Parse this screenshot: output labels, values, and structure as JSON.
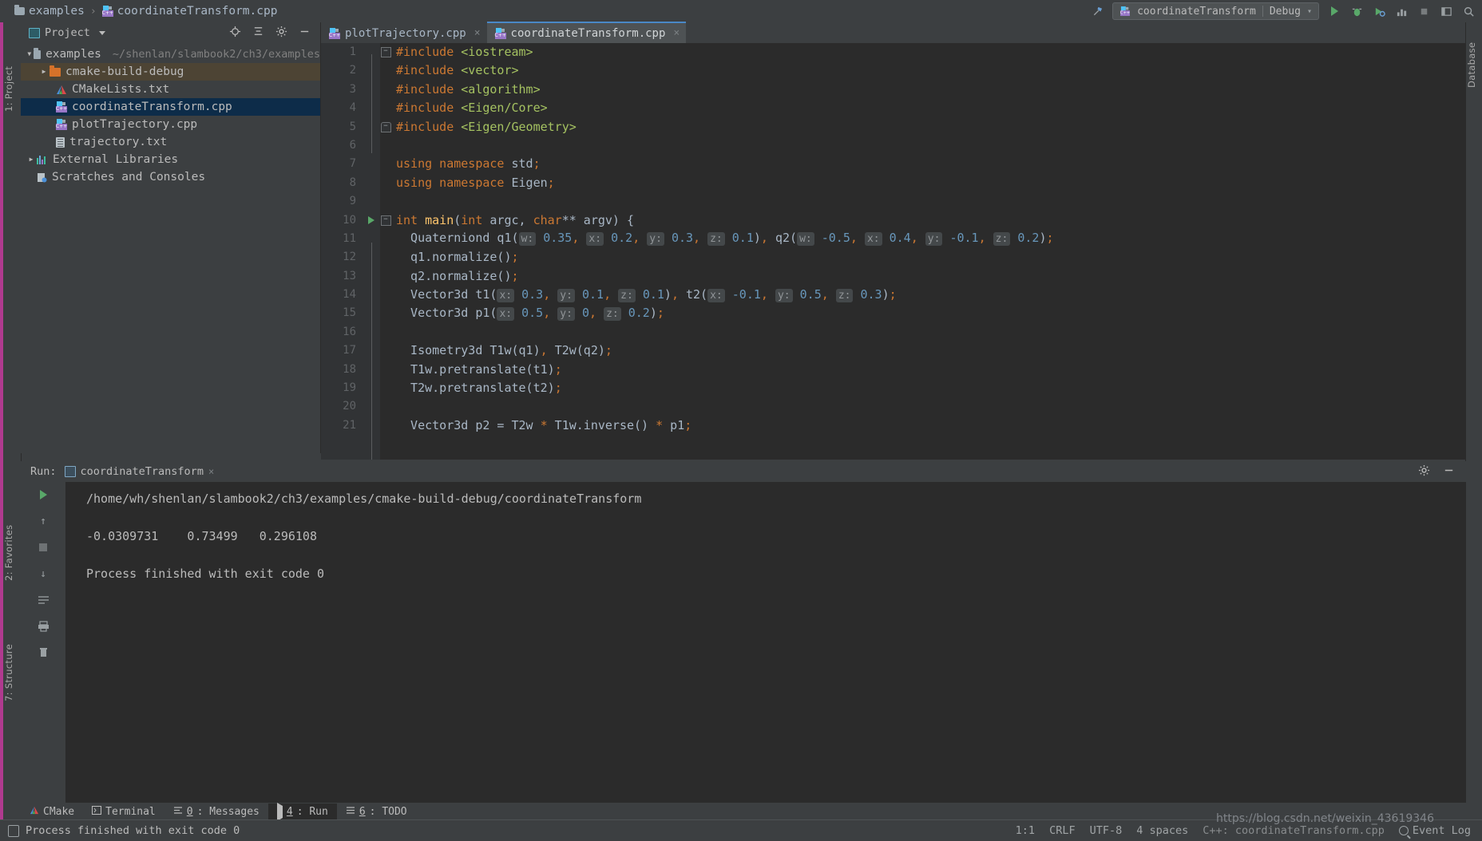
{
  "breadcrumb": {
    "folder": "examples",
    "file": "coordinateTransform.cpp",
    "separator": "›"
  },
  "toolbar": {
    "run_config": "coordinateTransform",
    "build_config": "Debug",
    "config_caret": "▾",
    "hammer_icon": "build-icon",
    "run_icon": "run-icon",
    "debug_icon": "debug-icon",
    "run_coverage_icon": "run-with-coverage-icon",
    "profile_icon": "profile-icon",
    "stop_icon": "stop-icon",
    "layout_icon": "layout-icon",
    "search_icon": "search-icon"
  },
  "left_strip": {
    "project_tab": "1: Project",
    "favorites_tab": "2: Favorites",
    "structure_tab": "7: Structure"
  },
  "right_strip": {
    "database_tab": "Database"
  },
  "project_panel": {
    "title": "Project",
    "caret": "▾",
    "locate_icon": "locate-icon",
    "collapse_icon": "collapse-all-icon",
    "settings_icon": "gear-icon",
    "hide_icon": "hide-icon",
    "tree": [
      {
        "label": "examples",
        "path": "~/shenlan/slambook2/ch3/examples",
        "icon": "folder-icon",
        "indent": 0,
        "arrow": "down",
        "state": "none"
      },
      {
        "label": "cmake-build-debug",
        "path": "",
        "icon": "folder-orange-icon",
        "indent": 1,
        "arrow": "right",
        "state": "amber"
      },
      {
        "label": "CMakeLists.txt",
        "path": "",
        "icon": "cmake-icon",
        "indent": 1,
        "arrow": "none",
        "state": "none"
      },
      {
        "label": "coordinateTransform.cpp",
        "path": "",
        "icon": "cpp-icon",
        "indent": 1,
        "arrow": "none",
        "state": "blue"
      },
      {
        "label": "plotTrajectory.cpp",
        "path": "",
        "icon": "cpp-icon",
        "indent": 1,
        "arrow": "none",
        "state": "none"
      },
      {
        "label": "trajectory.txt",
        "path": "",
        "icon": "text-file-icon",
        "indent": 1,
        "arrow": "none",
        "state": "none"
      },
      {
        "label": "External Libraries",
        "path": "",
        "icon": "library-icon",
        "indent": 0,
        "arrow": "right",
        "state": "none"
      },
      {
        "label": "Scratches and Consoles",
        "path": "",
        "icon": "scratch-icon",
        "indent": 0,
        "arrow": "none",
        "state": "none"
      }
    ]
  },
  "editor": {
    "tabs": [
      {
        "label": "plotTrajectory.cpp",
        "active": false,
        "close": "×"
      },
      {
        "label": "coordinateTransform.cpp",
        "active": true,
        "close": "×"
      }
    ],
    "lines": [
      {
        "n": 1,
        "mark": "fold-collapse",
        "tokens": [
          {
            "t": "#include ",
            "c": "kw"
          },
          {
            "t": "<iostream>",
            "c": "str"
          }
        ]
      },
      {
        "n": 2,
        "mark": "",
        "tokens": [
          {
            "t": "#include ",
            "c": "kw"
          },
          {
            "t": "<vector>",
            "c": "str"
          }
        ]
      },
      {
        "n": 3,
        "mark": "",
        "tokens": [
          {
            "t": "#include ",
            "c": "kw"
          },
          {
            "t": "<algorithm>",
            "c": "str"
          }
        ]
      },
      {
        "n": 4,
        "mark": "",
        "tokens": [
          {
            "t": "#include ",
            "c": "kw"
          },
          {
            "t": "<Eigen/Core>",
            "c": "str"
          }
        ]
      },
      {
        "n": 5,
        "mark": "fold-end",
        "tokens": [
          {
            "t": "#include ",
            "c": "kw"
          },
          {
            "t": "<Eigen/Geometry>",
            "c": "str"
          }
        ]
      },
      {
        "n": 6,
        "mark": "",
        "tokens": []
      },
      {
        "n": 7,
        "mark": "",
        "tokens": [
          {
            "t": "using namespace ",
            "c": "kw"
          },
          {
            "t": "std",
            "c": "type"
          },
          {
            "t": ";",
            "c": "punc"
          }
        ]
      },
      {
        "n": 8,
        "mark": "",
        "tokens": [
          {
            "t": "using namespace ",
            "c": "kw"
          },
          {
            "t": "Eigen",
            "c": "type"
          },
          {
            "t": ";",
            "c": "punc"
          }
        ]
      },
      {
        "n": 9,
        "mark": "",
        "tokens": []
      },
      {
        "n": 10,
        "mark": "run-gutter-fold",
        "tokens": [
          {
            "t": "int ",
            "c": "kw"
          },
          {
            "t": "main",
            "c": "fn"
          },
          {
            "t": "(",
            "c": "type"
          },
          {
            "t": "int",
            "c": "kw"
          },
          {
            "t": " argc, ",
            "c": "type"
          },
          {
            "t": "char",
            "c": "kw"
          },
          {
            "t": "** argv) {",
            "c": "type"
          }
        ]
      },
      {
        "n": 11,
        "mark": "",
        "tokens": [
          {
            "t": "  Quaterniond q1(",
            "c": "type"
          },
          {
            "t": "w:",
            "c": "hint"
          },
          {
            "t": " ",
            "c": "type"
          },
          {
            "t": "0.35",
            "c": "num"
          },
          {
            "t": ", ",
            "c": "punc"
          },
          {
            "t": "x:",
            "c": "hint"
          },
          {
            "t": " ",
            "c": "type"
          },
          {
            "t": "0.2",
            "c": "num"
          },
          {
            "t": ", ",
            "c": "punc"
          },
          {
            "t": "y:",
            "c": "hint"
          },
          {
            "t": " ",
            "c": "type"
          },
          {
            "t": "0.3",
            "c": "num"
          },
          {
            "t": ", ",
            "c": "punc"
          },
          {
            "t": "z:",
            "c": "hint"
          },
          {
            "t": " ",
            "c": "type"
          },
          {
            "t": "0.1",
            "c": "num"
          },
          {
            "t": ")",
            "c": "type"
          },
          {
            "t": ", ",
            "c": "punc"
          },
          {
            "t": "q2(",
            "c": "type"
          },
          {
            "t": "w:",
            "c": "hint"
          },
          {
            "t": " ",
            "c": "type"
          },
          {
            "t": "-0.5",
            "c": "num"
          },
          {
            "t": ", ",
            "c": "punc"
          },
          {
            "t": "x:",
            "c": "hint"
          },
          {
            "t": " ",
            "c": "type"
          },
          {
            "t": "0.4",
            "c": "num"
          },
          {
            "t": ", ",
            "c": "punc"
          },
          {
            "t": "y:",
            "c": "hint"
          },
          {
            "t": " ",
            "c": "type"
          },
          {
            "t": "-0.1",
            "c": "num"
          },
          {
            "t": ", ",
            "c": "punc"
          },
          {
            "t": "z:",
            "c": "hint"
          },
          {
            "t": " ",
            "c": "type"
          },
          {
            "t": "0.2",
            "c": "num"
          },
          {
            "t": ")",
            "c": "type"
          },
          {
            "t": ";",
            "c": "punc"
          }
        ]
      },
      {
        "n": 12,
        "mark": "",
        "tokens": [
          {
            "t": "  q1.normalize()",
            "c": "type"
          },
          {
            "t": ";",
            "c": "punc"
          }
        ]
      },
      {
        "n": 13,
        "mark": "",
        "tokens": [
          {
            "t": "  q2.normalize()",
            "c": "type"
          },
          {
            "t": ";",
            "c": "punc"
          }
        ]
      },
      {
        "n": 14,
        "mark": "",
        "tokens": [
          {
            "t": "  Vector3d t1(",
            "c": "type"
          },
          {
            "t": "x:",
            "c": "hint"
          },
          {
            "t": " ",
            "c": "type"
          },
          {
            "t": "0.3",
            "c": "num"
          },
          {
            "t": ", ",
            "c": "punc"
          },
          {
            "t": "y:",
            "c": "hint"
          },
          {
            "t": " ",
            "c": "type"
          },
          {
            "t": "0.1",
            "c": "num"
          },
          {
            "t": ", ",
            "c": "punc"
          },
          {
            "t": "z:",
            "c": "hint"
          },
          {
            "t": " ",
            "c": "type"
          },
          {
            "t": "0.1",
            "c": "num"
          },
          {
            "t": ")",
            "c": "type"
          },
          {
            "t": ", ",
            "c": "punc"
          },
          {
            "t": "t2(",
            "c": "type"
          },
          {
            "t": "x:",
            "c": "hint"
          },
          {
            "t": " ",
            "c": "type"
          },
          {
            "t": "-0.1",
            "c": "num"
          },
          {
            "t": ", ",
            "c": "punc"
          },
          {
            "t": "y:",
            "c": "hint"
          },
          {
            "t": " ",
            "c": "type"
          },
          {
            "t": "0.5",
            "c": "num"
          },
          {
            "t": ", ",
            "c": "punc"
          },
          {
            "t": "z:",
            "c": "hint"
          },
          {
            "t": " ",
            "c": "type"
          },
          {
            "t": "0.3",
            "c": "num"
          },
          {
            "t": ")",
            "c": "type"
          },
          {
            "t": ";",
            "c": "punc"
          }
        ]
      },
      {
        "n": 15,
        "mark": "",
        "tokens": [
          {
            "t": "  Vector3d p1(",
            "c": "type"
          },
          {
            "t": "x:",
            "c": "hint"
          },
          {
            "t": " ",
            "c": "type"
          },
          {
            "t": "0.5",
            "c": "num"
          },
          {
            "t": ", ",
            "c": "punc"
          },
          {
            "t": "y:",
            "c": "hint"
          },
          {
            "t": " ",
            "c": "type"
          },
          {
            "t": "0",
            "c": "num"
          },
          {
            "t": ", ",
            "c": "punc"
          },
          {
            "t": "z:",
            "c": "hint"
          },
          {
            "t": " ",
            "c": "type"
          },
          {
            "t": "0.2",
            "c": "num"
          },
          {
            "t": ")",
            "c": "type"
          },
          {
            "t": ";",
            "c": "punc"
          }
        ]
      },
      {
        "n": 16,
        "mark": "",
        "tokens": []
      },
      {
        "n": 17,
        "mark": "",
        "tokens": [
          {
            "t": "  Isometry3d T1w(q1)",
            "c": "type"
          },
          {
            "t": ", ",
            "c": "punc"
          },
          {
            "t": "T2w(q2)",
            "c": "type"
          },
          {
            "t": ";",
            "c": "punc"
          }
        ]
      },
      {
        "n": 18,
        "mark": "",
        "tokens": [
          {
            "t": "  T1w.pretranslate(t1)",
            "c": "type"
          },
          {
            "t": ";",
            "c": "punc"
          }
        ]
      },
      {
        "n": 19,
        "mark": "",
        "tokens": [
          {
            "t": "  T2w.pretranslate(t2)",
            "c": "type"
          },
          {
            "t": ";",
            "c": "punc"
          }
        ]
      },
      {
        "n": 20,
        "mark": "",
        "tokens": []
      },
      {
        "n": 21,
        "mark": "",
        "tokens": [
          {
            "t": "  Vector3d p2 = T2w ",
            "c": "type"
          },
          {
            "t": "*",
            "c": "punc"
          },
          {
            "t": " T1w.inverse() ",
            "c": "type"
          },
          {
            "t": "*",
            "c": "punc"
          },
          {
            "t": " p1",
            "c": "type"
          },
          {
            "t": ";",
            "c": "punc"
          }
        ]
      }
    ]
  },
  "run_panel": {
    "label": "Run:",
    "tab": "coordinateTransform",
    "close": "×",
    "settings_icon": "gear-icon",
    "minimize_icon": "minimize-icon",
    "gutter_icons": [
      "rerun-icon",
      "scroll-up-icon",
      "stop-icon",
      "scroll-down-icon",
      "soft-wrap-icon",
      "print-icon",
      "clear-all-icon"
    ],
    "console": [
      "/home/wh/shenlan/slambook2/ch3/examples/cmake-build-debug/coordinateTransform",
      "",
      "-0.0309731    0.73499   0.296108",
      "",
      "Process finished with exit code 0"
    ]
  },
  "tool_windows": [
    {
      "label": "CMake",
      "icon": "cmake-icon",
      "key": "",
      "active": false
    },
    {
      "label": "Terminal",
      "icon": "terminal-icon",
      "key": "",
      "active": false
    },
    {
      "label": ": Messages",
      "icon": "messages-icon",
      "key": "0",
      "active": false
    },
    {
      "label": ": Run",
      "icon": "run-icon",
      "key": "4",
      "active": true
    },
    {
      "label": ": TODO",
      "icon": "todo-icon",
      "key": "6",
      "active": false
    }
  ],
  "status_bar": {
    "message": "Process finished with exit code 0",
    "caret": "1:1",
    "line_sep": "CRLF",
    "encoding": "UTF-8",
    "indent": "4 spaces",
    "lang": "C++:",
    "context": "coordinateTransform.cpp",
    "event_log": "Event Log"
  },
  "watermark": {
    "url": "https://blog.csdn.net/weixin_43619346"
  },
  "colors": {
    "bg_panel": "#3c3f41",
    "bg_editor": "#2b2b2b",
    "accent_blue": "#4a88c7",
    "sel_blue": "#0d2c49",
    "sel_amber": "#4d4434",
    "keyword": "#cc7832",
    "string": "#a5c261",
    "number": "#6897bb",
    "function": "#ffc66d",
    "text": "#a9b7c6",
    "run_green": "#59a869",
    "magenta_edge": "#b03a8f"
  }
}
